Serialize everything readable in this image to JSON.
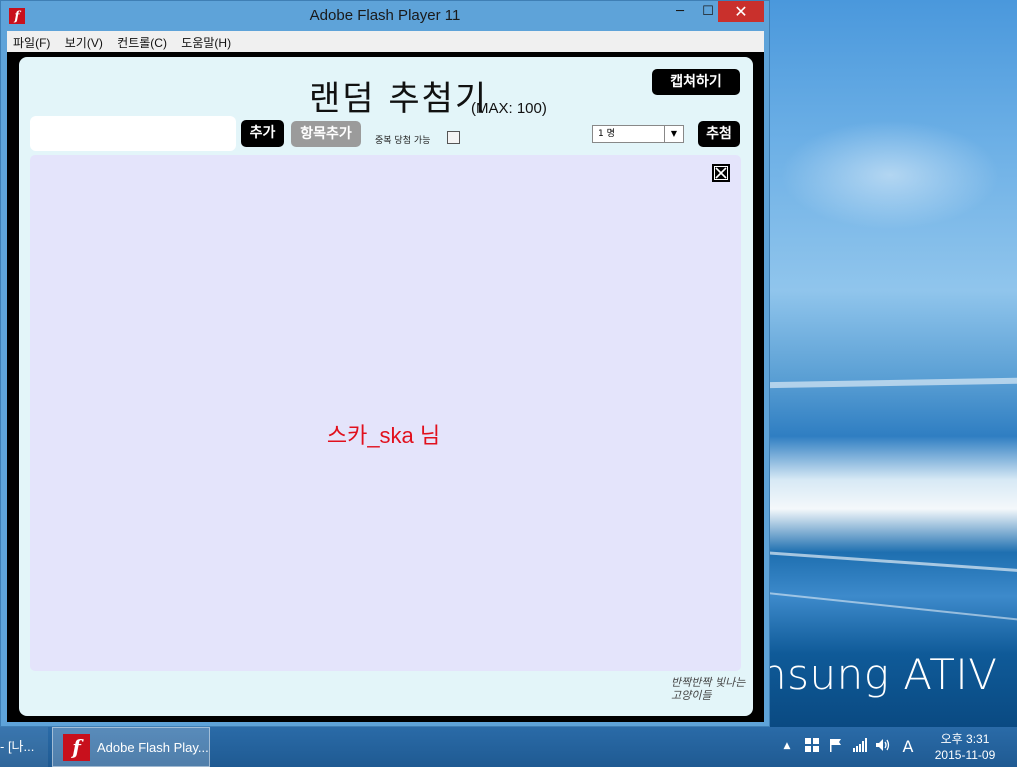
{
  "window": {
    "title": "Adobe Flash Player 11",
    "controls": {
      "minimize": "─",
      "maximize": "☐",
      "close": "✕"
    },
    "menus": [
      "파일(F)",
      "보기(V)",
      "컨트롤(C)",
      "도움말(H)"
    ]
  },
  "app": {
    "title": "랜덤 추첨기",
    "max_note": "(MAX: 100)",
    "capture_button": "캡쳐하기",
    "input_value": "",
    "add_button": "추가",
    "add_item_button": "항목추가",
    "duplicate_label": "중복 당첨 가능",
    "duplicate_checked": false,
    "count_value": "1 명",
    "draw_button": "추첨",
    "result": "스카_ska 님",
    "signature_line1": "반짝반짝 빛나는",
    "signature_line2": "고양이들"
  },
  "desktop": {
    "brand": "nsung ATIV"
  },
  "taskbar": {
    "items": [
      {
        "label": "- [나..."
      },
      {
        "label": "Adobe Flash Play..."
      }
    ],
    "tray_icons": [
      "chevron-up-icon",
      "windows-icon",
      "flag-icon",
      "signal-icon",
      "volume-icon",
      "ime-icon"
    ],
    "ime_text": "A",
    "time": "오후 3:31",
    "date": "2015-11-09"
  },
  "colors": {
    "accent_red": "#e1101d",
    "panel": "#e4e4fb",
    "stage": "#e3f5f9"
  }
}
